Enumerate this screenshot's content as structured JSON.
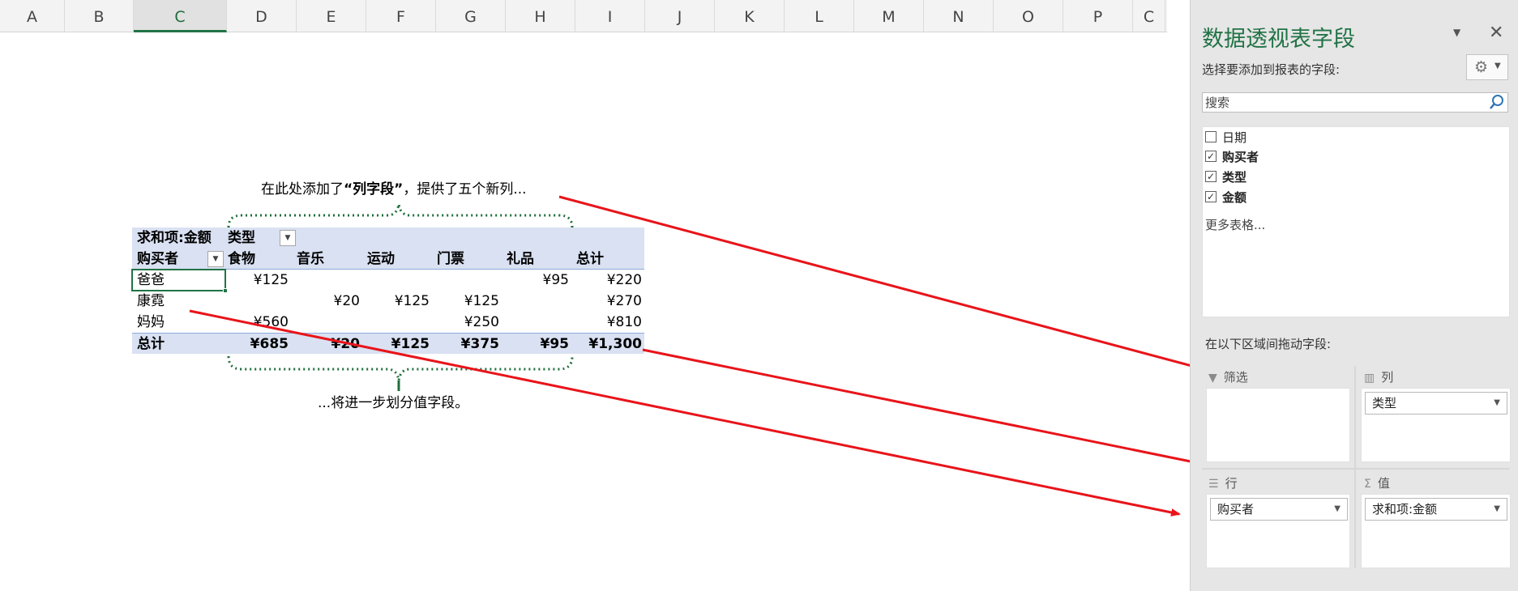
{
  "sheet": {
    "columns": [
      "A",
      "B",
      "C",
      "D",
      "E",
      "F",
      "G",
      "H",
      "I",
      "J",
      "K",
      "L",
      "M",
      "N",
      "O",
      "P",
      "C"
    ],
    "selected_column": "C"
  },
  "pivot": {
    "header": {
      "values_label": "求和项:金额",
      "col_field_label": "类型"
    },
    "subheader": {
      "row_field_label": "购买者",
      "categories": [
        "食物",
        "音乐",
        "运动",
        "门票",
        "礼品",
        "总计"
      ]
    },
    "rows": [
      {
        "name": "爸爸",
        "values": [
          "¥125",
          "",
          "",
          "",
          "¥95",
          "¥220"
        ]
      },
      {
        "name": "康霓",
        "values": [
          "",
          "¥20",
          "¥125",
          "¥125",
          "",
          "¥270"
        ]
      },
      {
        "name": "妈妈",
        "values": [
          "¥560",
          "",
          "",
          "¥250",
          "",
          "¥810"
        ]
      }
    ],
    "total": {
      "name": "总计",
      "values": [
        "¥685",
        "¥20",
        "¥125",
        "¥375",
        "¥95",
        "¥1,300"
      ]
    }
  },
  "callouts": {
    "top_prefix": "在此处添加了",
    "top_bold": "“列字段”",
    "top_suffix": "，提供了五个新列...",
    "bottom": "...将进一步划分值字段。"
  },
  "pane": {
    "title": "数据透视表字段",
    "choose_label": "选择要添加到报表的字段:",
    "search_placeholder": "搜索",
    "fields": [
      {
        "label": "日期",
        "checked": false
      },
      {
        "label": "购买者",
        "checked": true
      },
      {
        "label": "类型",
        "checked": true
      },
      {
        "label": "金额",
        "checked": true
      }
    ],
    "more_tables": "更多表格...",
    "drag_label": "在以下区域间拖动字段:",
    "areas": {
      "filter_title": "筛选",
      "columns_title": "列",
      "rows_title": "行",
      "values_title": "值",
      "columns_pill": "类型",
      "rows_pill": "购买者",
      "values_pill": "求和项:金额"
    },
    "colors": {
      "accent": "#217346",
      "arrow": "#e8141a",
      "pivot_header": "#d9e1f2"
    }
  }
}
